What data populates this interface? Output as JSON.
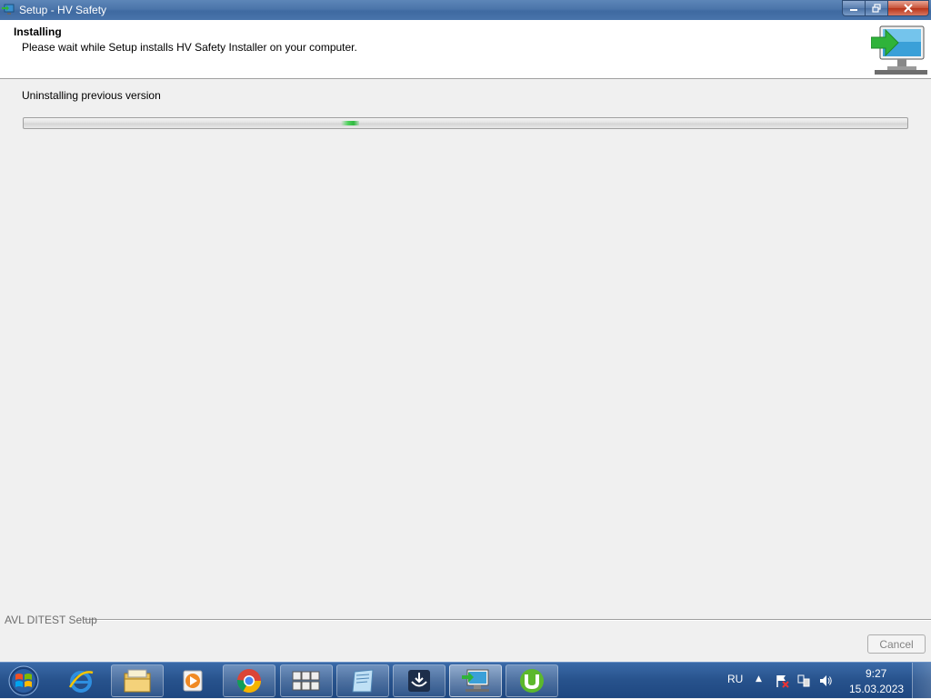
{
  "window": {
    "title": "Setup - HV Safety",
    "controls": {
      "minimize": "minimize",
      "maximize": "maximize",
      "close": "close"
    }
  },
  "header": {
    "title": "Installing",
    "subtitle": "Please wait while Setup installs HV Safety Installer on your computer."
  },
  "status": {
    "text": "Uninstalling previous version",
    "progress_mode": "marquee"
  },
  "footer": {
    "brand": "AVL DITEST Setup",
    "cancel_label": "Cancel"
  },
  "taskbar": {
    "items": [
      {
        "name": "internet-explorer-icon"
      },
      {
        "name": "file-explorer-icon"
      },
      {
        "name": "media-player-icon"
      },
      {
        "name": "chrome-icon"
      },
      {
        "name": "keyboard-app-icon"
      },
      {
        "name": "notepad-icon"
      },
      {
        "name": "remote-app-icon"
      },
      {
        "name": "setup-installer-icon"
      },
      {
        "name": "utorrent-icon"
      }
    ],
    "language": "RU",
    "clock_time": "9:27",
    "clock_date": "15.03.2023"
  },
  "colors": {
    "titlebar": "#4b75aa",
    "taskbar": "#27528c",
    "progress_accent": "#4cd15a",
    "header_bg": "#ffffff",
    "window_bg": "#f0f0f0"
  }
}
